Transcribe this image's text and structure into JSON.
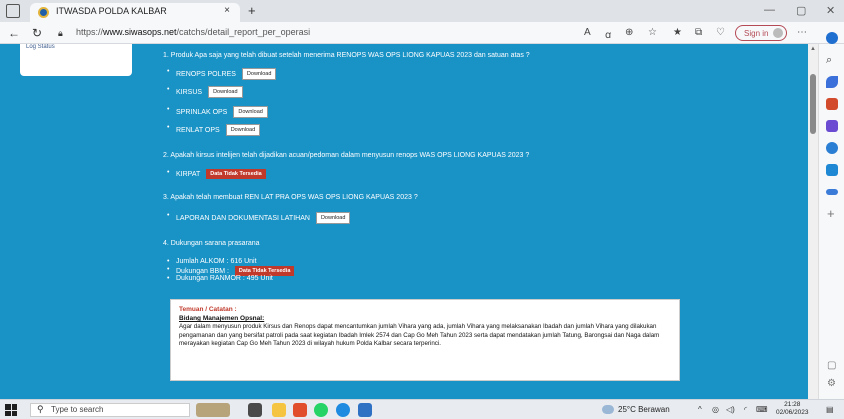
{
  "browser": {
    "tab_title": "ITWASDA POLDA KALBAR",
    "tab_close": "×",
    "new_tab": "+",
    "url_prefix": "https://",
    "url_host": "www.siwasops.net",
    "url_path": "/catchs/detail_report_per_operasi",
    "signin_label": "Sign in",
    "minimize": "—",
    "restore": "▢",
    "close": "✕"
  },
  "sidebar": {
    "logout_label": "Log Status"
  },
  "report": {
    "q1": "1. Produk Apa saja yang telah dibuat setelah menerima RENOPS WAS OPS LIONG KAPUAS 2023 dan satuan atas ?",
    "q1_items": [
      {
        "label": "RENOPS POLRES",
        "button": "Download"
      },
      {
        "label": "KIRSUS",
        "button": "Download"
      },
      {
        "label": "SPRINLAK OPS",
        "button": "Download"
      },
      {
        "label": "RENLAT OPS",
        "button": "Download"
      }
    ],
    "q2": "2. Apakah kirsus intelijen telah dijadikan acuan/pedoman dalam menyusun renops WAS OPS LIONG KAPUAS 2023 ?",
    "q2_item": {
      "label": "KIRPAT",
      "badge": "Data Tidak Tersedia"
    },
    "q3": "3. Apakah telah membuat REN LAT PRA OPS WAS OPS LIONG KAPUAS 2023 ?",
    "q3_item": {
      "label": "LAPORAN DAN DOKUMENTASI LATIHAN",
      "button": "Download"
    },
    "q4": "4. Dukungan sarana prasarana",
    "q4_items": [
      {
        "label": "Jumlah ALKOM : 616 Unit"
      },
      {
        "label": "Dukungan BBM :",
        "badge": "Data Tidak Tersedia"
      },
      {
        "label": "Dukungan RANMOR : 495 Unit"
      }
    ],
    "note": {
      "title": "Temuan / Catatan :",
      "heading": "Bidang Manajemen Opsnal:",
      "body": "Agar dalam menyusun produk Kirsus dan Renops dapat mencantumkan jumlah Vihara yang ada, jumlah Vihara yang melaksanakan Ibadah dan jumlah Vihara yang dilakukan pengamanan dan yang bersifat patroli pada saat kegiatan Ibadah Imlek 2574 dan Cap Go Meh Tahun 2023 serta dapat mendatakan jumlah Tatung, Barongsai dan Naga dalam merayakan kegiatan Cap Go Meh Tahun 2023 di wilayah hukum Polda Kalbar secara terperinci."
    }
  },
  "taskbar": {
    "search_placeholder": "Type to search",
    "weather": "25°C Berawan",
    "time": "21:28",
    "date": "02/06/2023"
  }
}
